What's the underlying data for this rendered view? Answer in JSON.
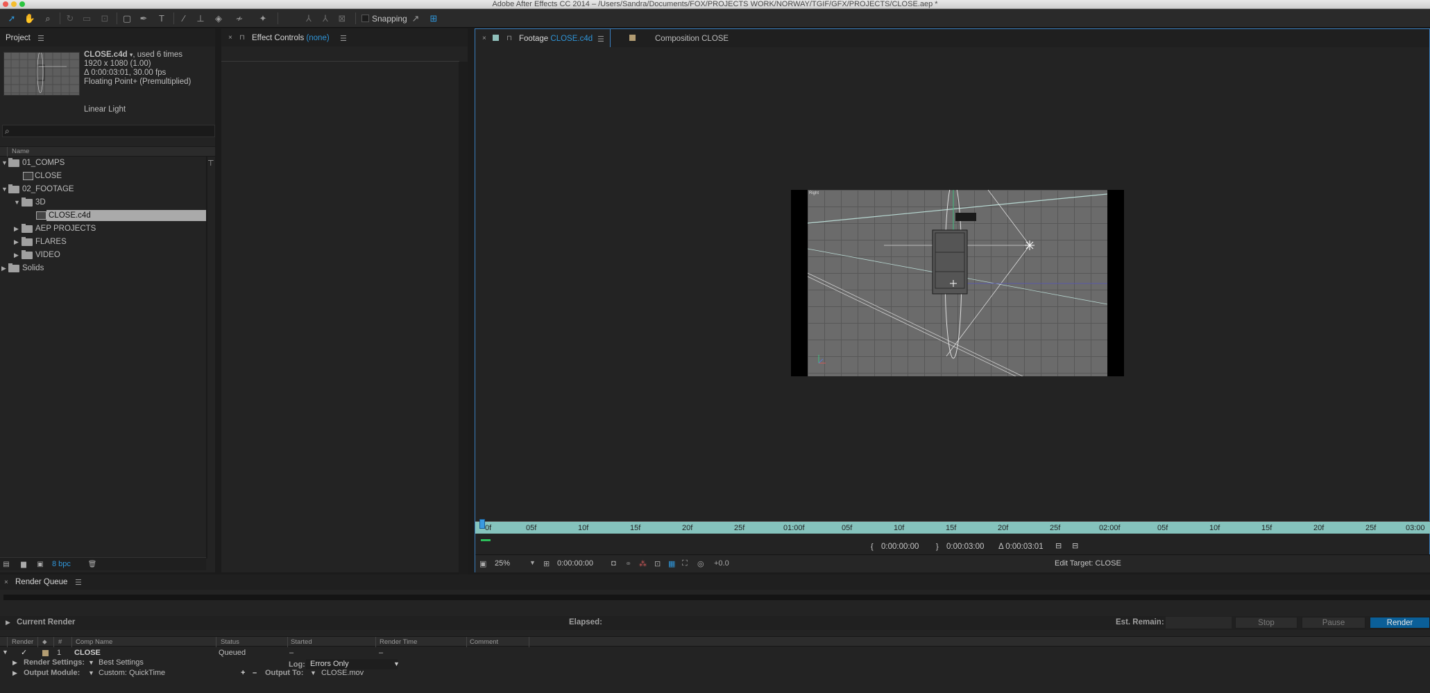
{
  "window": {
    "title": "Adobe After Effects CC 2014 – /Users/Sandra/Documents/FOX/PROJECTS WORK/NORWAY/TGIF/GFX/PROJECTS/CLOSE.aep *"
  },
  "toolbar": {
    "snapping_label": "Snapping"
  },
  "project": {
    "tab_label": "Project",
    "info": {
      "name": "CLOSE.c4d",
      "usage": ", used 6 times",
      "resolution": "1920 x 1080 (1.00)",
      "duration": "Δ 0:00:03:01, 30.00 fps",
      "color": "Floating Point+ (Premultiplied)",
      "profile": "Linear Light"
    },
    "column_name": "Name",
    "tree": [
      {
        "label": "01_COMPS"
      },
      {
        "label": "CLOSE"
      },
      {
        "label": "02_FOOTAGE"
      },
      {
        "label": "3D"
      },
      {
        "label": "CLOSE.c4d"
      },
      {
        "label": "AEP PROJECTS"
      },
      {
        "label": "FLARES"
      },
      {
        "label": "VIDEO"
      },
      {
        "label": "Solids"
      }
    ],
    "bpc": "8 bpc"
  },
  "effects": {
    "tab_label": "Effect Controls",
    "tab_target": "(none)"
  },
  "viewer": {
    "footage_tab_prefix": "Footage",
    "footage_tab_name": "CLOSE.c4d",
    "composition_tab": "Composition CLOSE",
    "viewport_label": "Right",
    "ruler_ticks": [
      "0f",
      "05f",
      "10f",
      "15f",
      "20f",
      "25f",
      "01:00f",
      "05f",
      "10f",
      "15f",
      "20f",
      "25f",
      "02:00f",
      "05f",
      "10f",
      "15f",
      "20f",
      "25f",
      "03:00"
    ],
    "in_point": "0:00:00:00",
    "out_point": "0:00:03:00",
    "duration": "Δ 0:00:03:01",
    "zoom": "25%",
    "current_time": "0:00:00:00",
    "exposure": "+0.0",
    "edit_target": "Edit Target: CLOSE"
  },
  "render_queue": {
    "tab_label": "Render Queue",
    "current_render": "Current Render",
    "elapsed_label": "Elapsed:",
    "remain_label": "Est. Remain:",
    "buttons": {
      "stop": "Stop",
      "pause": "Pause",
      "render": "Render"
    },
    "columns": [
      "Render",
      "#",
      "Comp Name",
      "Status",
      "Started",
      "Render Time",
      "Comment"
    ],
    "item": {
      "index": "1",
      "comp": "CLOSE",
      "status": "Queued",
      "started": "–",
      "render_time": "–",
      "render_settings_label": "Render Settings:",
      "render_settings_value": "Best Settings",
      "log_label": "Log:",
      "log_value": "Errors Only",
      "output_module_label": "Output Module:",
      "output_module_value": "Custom: QuickTime",
      "output_to_label": "Output To:",
      "output_to_value": "CLOSE.mov"
    }
  },
  "colors": {
    "accent": "#2f95d8",
    "label_tan": "#b29c72",
    "ruler": "#85c3bd",
    "render_button": "#0b5f98"
  }
}
